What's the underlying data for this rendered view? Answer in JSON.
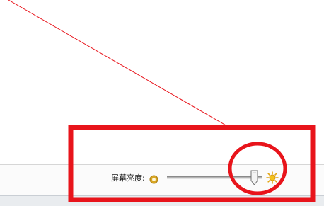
{
  "brightness": {
    "label": "屏幕亮度:",
    "level": 0.95
  },
  "icons": {
    "dim": "dim-brightness-icon",
    "bright": "sun-brightness-icon"
  },
  "colors": {
    "annotation": "#e8141b",
    "dim_icon": "#d8a623",
    "bright_icon": "#f3c21b"
  }
}
